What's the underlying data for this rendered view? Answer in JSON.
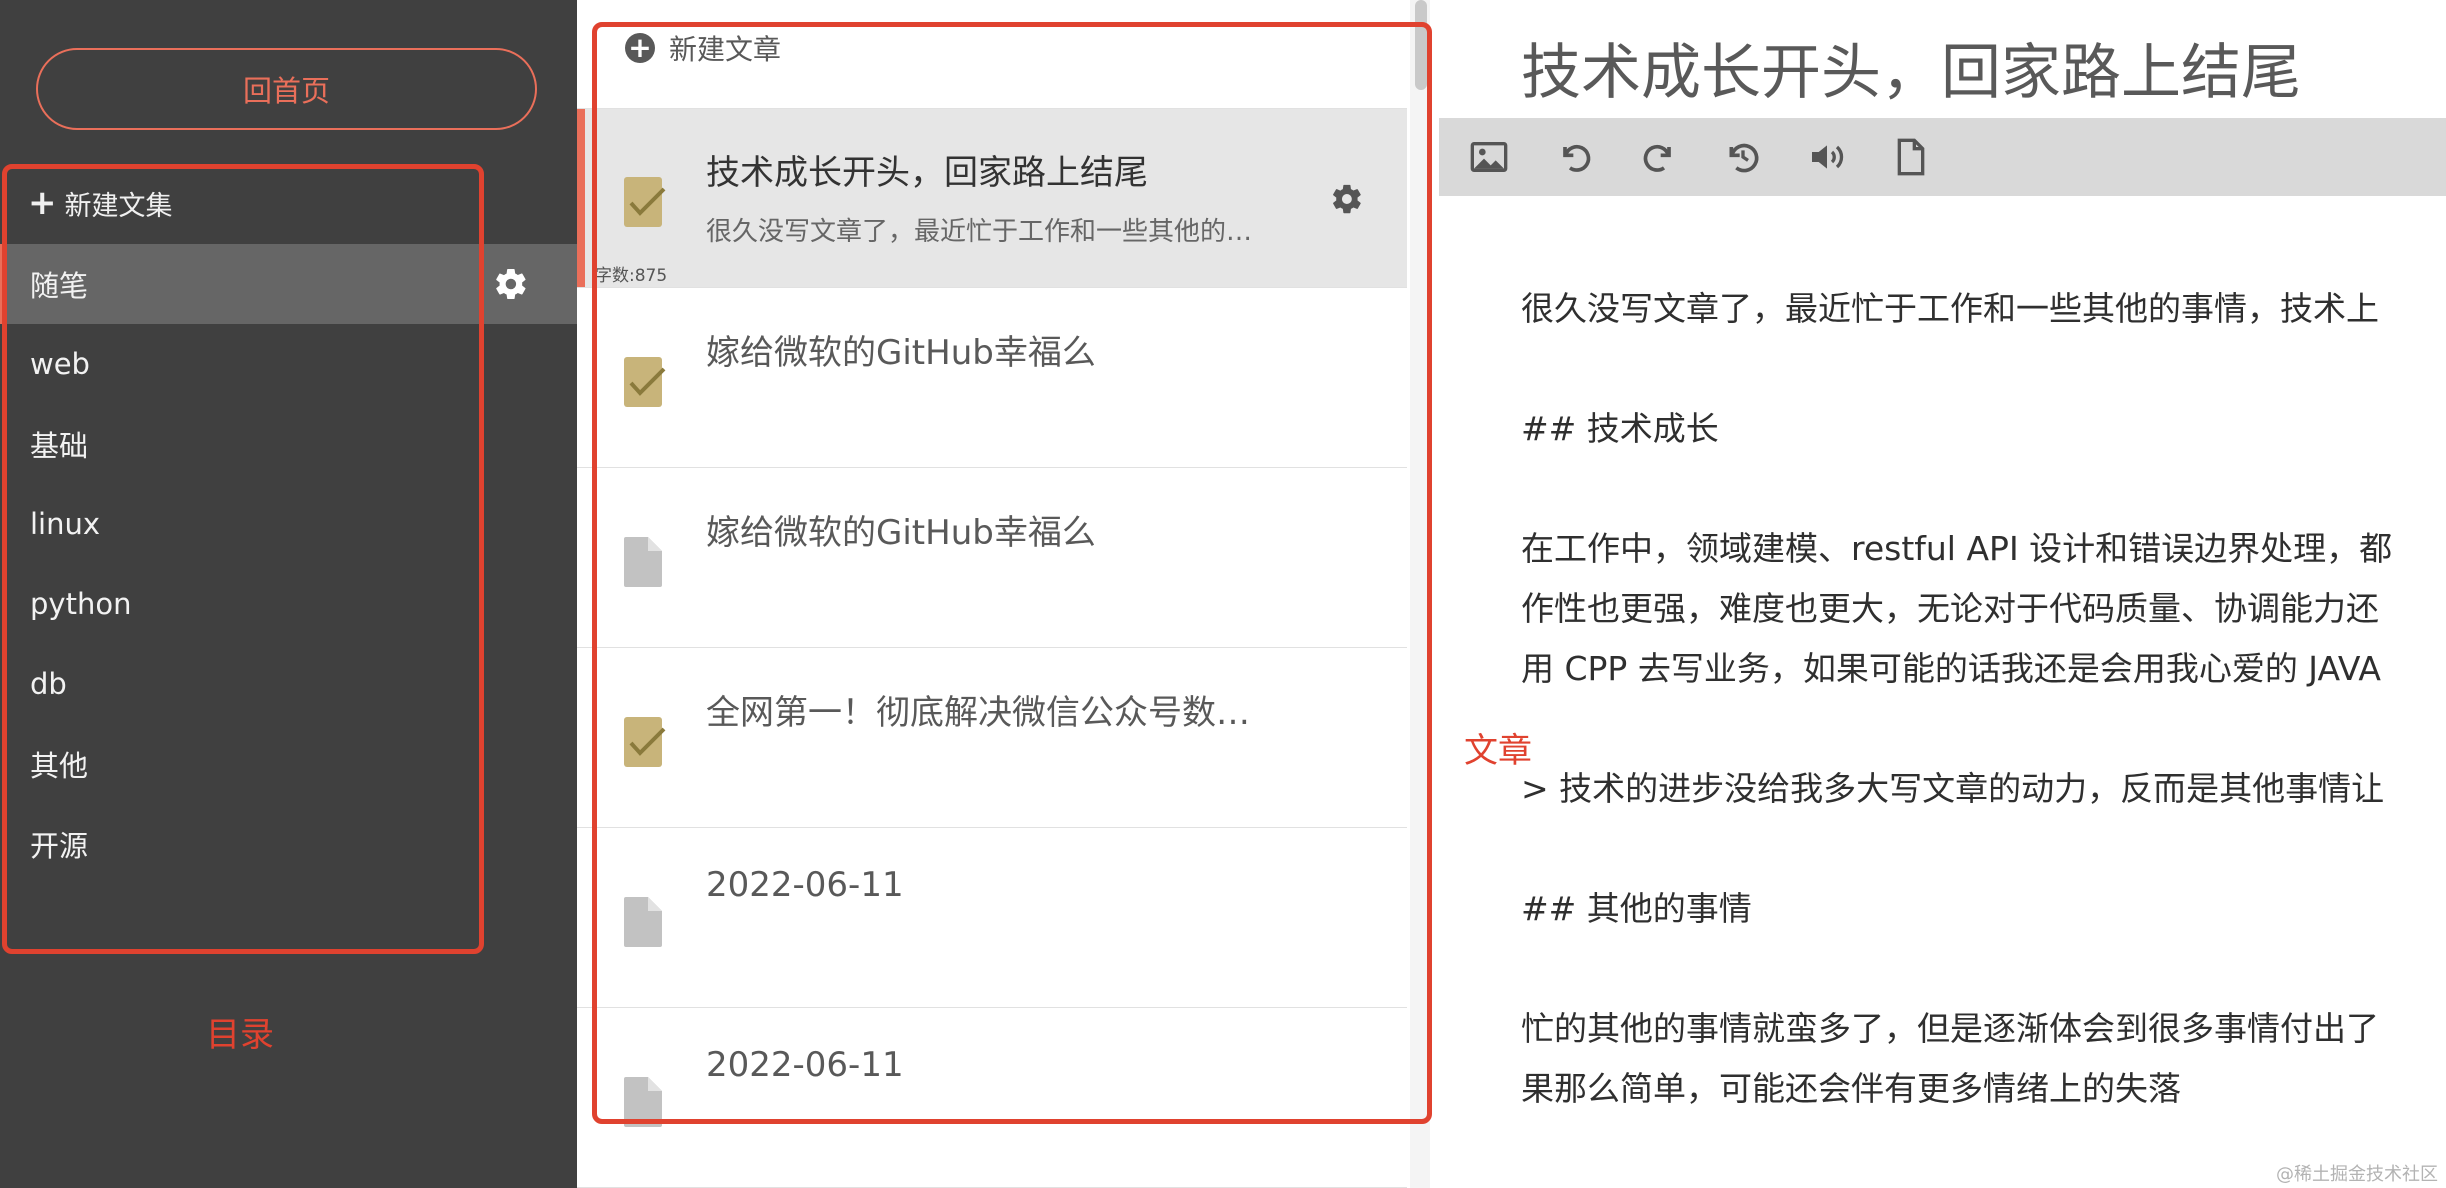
{
  "sidebar": {
    "home_label": "回首页",
    "new_notebook_label": "新建文集",
    "notebooks": [
      {
        "label": "随笔",
        "active": true
      },
      {
        "label": "web"
      },
      {
        "label": "基础"
      },
      {
        "label": "linux"
      },
      {
        "label": "python"
      },
      {
        "label": "db"
      },
      {
        "label": "其他"
      },
      {
        "label": "开源"
      }
    ]
  },
  "notelist": {
    "new_note_label": "新建文章",
    "notes": [
      {
        "title": "技术成长开头，回家路上结尾",
        "abstract": "很久没写文章了，最近忙于工作和一些其他的…",
        "words": "字数:875",
        "icon": "checked-note-icon",
        "active": true
      },
      {
        "title": "嫁给微软的GitHub幸福么",
        "icon": "checked-note-icon"
      },
      {
        "title": "嫁给微软的GitHub幸福么",
        "icon": "file-icon"
      },
      {
        "title": "全网第一！彻底解决微信公众号数…",
        "icon": "checked-note-icon"
      },
      {
        "title": "2022-06-11",
        "icon": "file-icon"
      },
      {
        "title": "2022-06-11",
        "icon": "file-icon"
      }
    ]
  },
  "editor": {
    "title": "技术成长开头，回家路上结尾",
    "toolbar": [
      "image-icon",
      "undo-icon",
      "redo-icon",
      "history-icon",
      "volume-icon",
      "document-icon"
    ],
    "lines": [
      "很久没写文章了，最近忙于工作和一些其他的事情，技术上",
      "## 技术成长",
      "在工作中，领域建模、restful API 设计和错误边界处理，都",
      "作性也更强，难度也更大，无论对于代码质量、协调能力还",
      "用 CPP 去写业务，如果可能的话我还是会用我心爱的 JAVA",
      "> 技术的进步没给我多大写文章的动力，反而是其他事情让",
      "## 其他的事情",
      "忙的其他的事情就蛮多了，但是逐渐体会到很多事情付出了",
      "果那么简单，可能还会伴有更多情绪上的失落"
    ]
  },
  "annotations": {
    "catalog_label": "目录",
    "article_label": "文章"
  },
  "watermark": "@稀土掘金技术社区",
  "colors": {
    "accent": "#ea6f5a",
    "annotation_red": "#e0422f",
    "sidebar_bg": "#404040",
    "active_item_bg": "#666666",
    "toolbar_bg": "#d9d9d9",
    "note_active_bg": "#e6e6e6",
    "checked_icon": "#c8b47a"
  }
}
